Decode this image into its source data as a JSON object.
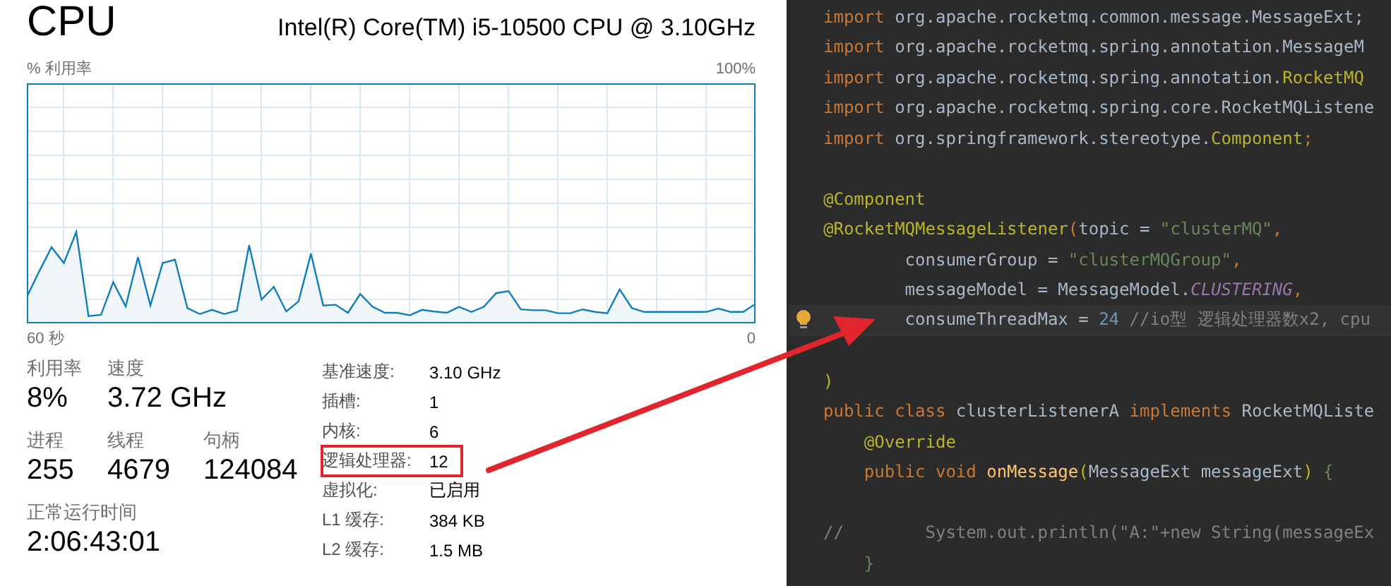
{
  "cpu_panel": {
    "title": "CPU",
    "processor": "Intel(R) Core(TM) i5-10500 CPU @ 3.10GHz",
    "graph": {
      "y_label": "% 利用率",
      "y_max_label": "100%",
      "x_start_label": "60 秒",
      "x_end_label": "0"
    },
    "stats": [
      {
        "label": "利用率",
        "value": "8%"
      },
      {
        "label": "速度",
        "value": "3.72 GHz"
      },
      {
        "label": "进程",
        "value": "255"
      },
      {
        "label": "线程",
        "value": "4679"
      },
      {
        "label": "句柄",
        "value": "124084"
      },
      {
        "label": "正常运行时间",
        "value": "2:06:43:01"
      }
    ],
    "specs": [
      {
        "label": "基准速度:",
        "value": "3.10 GHz",
        "highlighted": false
      },
      {
        "label": "插槽:",
        "value": "1",
        "highlighted": false
      },
      {
        "label": "内核:",
        "value": "6",
        "highlighted": false
      },
      {
        "label": "逻辑处理器:",
        "value": "12",
        "highlighted": true
      },
      {
        "label": "虚拟化:",
        "value": "已启用",
        "highlighted": false
      },
      {
        "label": "L1 缓存:",
        "value": "384 KB",
        "highlighted": false
      },
      {
        "label": "L2 缓存:",
        "value": "1.5 MB",
        "highlighted": false
      }
    ]
  },
  "editor": {
    "lines": [
      {
        "current": false,
        "tokens": [
          {
            "kind": "keyword",
            "text": "import"
          },
          {
            "kind": "plain",
            "text": " org.apache.rocketmq.common.message.MessageExt;"
          }
        ]
      },
      {
        "current": false,
        "tokens": [
          {
            "kind": "keyword",
            "text": "import"
          },
          {
            "kind": "plain",
            "text": " org.apache.rocketmq.spring.annotation.MessageM"
          }
        ]
      },
      {
        "current": false,
        "tokens": [
          {
            "kind": "keyword",
            "text": "import"
          },
          {
            "kind": "plain",
            "text": " org.apache.rocketmq.spring.annotation."
          },
          {
            "kind": "annotation",
            "text": "RocketMQ"
          }
        ]
      },
      {
        "current": false,
        "tokens": [
          {
            "kind": "keyword",
            "text": "import"
          },
          {
            "kind": "plain",
            "text": " org.apache.rocketmq.spring.core.RocketMQListene"
          }
        ]
      },
      {
        "current": false,
        "tokens": [
          {
            "kind": "keyword",
            "text": "import"
          },
          {
            "kind": "plain",
            "text": " org.springframework.stereotype."
          },
          {
            "kind": "annotation",
            "text": "Component"
          },
          {
            "kind": "keyword",
            "text": ";"
          }
        ]
      },
      {
        "current": false
      },
      {
        "current": false,
        "tokens": [
          {
            "kind": "annotation",
            "text": "@Component"
          }
        ]
      },
      {
        "current": false,
        "tokens": [
          {
            "kind": "annotation",
            "text": "@RocketMQMessageListener"
          },
          {
            "kind": "keyword",
            "text": "("
          },
          {
            "kind": "plain",
            "text": "topic = "
          },
          {
            "kind": "string",
            "text": "\"clusterMQ\""
          },
          {
            "kind": "keyword",
            "text": ","
          }
        ]
      },
      {
        "current": false,
        "tokens": [
          {
            "kind": "plain",
            "text": "        consumerGroup = "
          },
          {
            "kind": "string",
            "text": "\"clusterMQGroup\""
          },
          {
            "kind": "keyword",
            "text": ","
          }
        ]
      },
      {
        "current": false,
        "tokens": [
          {
            "kind": "plain",
            "text": "        messageModel = MessageModel."
          },
          {
            "kind": "constant",
            "text": "CLUSTERING"
          },
          {
            "kind": "keyword",
            "text": ","
          }
        ]
      },
      {
        "current": true,
        "tokens": [
          {
            "kind": "plain",
            "text": "        consumeThreadMax = "
          },
          {
            "kind": "number",
            "text": "24"
          },
          {
            "kind": "comment",
            "text": " //io型 逻辑处理器数x2, cpu"
          }
        ]
      },
      {
        "current": false
      },
      {
        "current": false,
        "tokens": [
          {
            "kind": "annotation",
            "text": ")"
          }
        ]
      },
      {
        "current": false,
        "tokens": [
          {
            "kind": "keyword",
            "text": "public class"
          },
          {
            "kind": "plain",
            "text": " clusterListenerA "
          },
          {
            "kind": "keyword",
            "text": "implements"
          },
          {
            "kind": "plain",
            "text": " RocketMQListe"
          }
        ]
      },
      {
        "current": false,
        "tokens": [
          {
            "kind": "annotation",
            "text": "    @Override"
          }
        ]
      },
      {
        "current": false,
        "tokens": [
          {
            "kind": "keyword",
            "text": "    public void"
          },
          {
            "kind": "method",
            "text": " onMessage"
          },
          {
            "kind": "annotation",
            "text": "("
          },
          {
            "kind": "plain",
            "text": "MessageExt messageExt"
          },
          {
            "kind": "annotation",
            "text": ")"
          },
          {
            "kind": "brace",
            "text": " {"
          }
        ]
      },
      {
        "current": false
      },
      {
        "current": false,
        "tokens": [
          {
            "kind": "comment",
            "text": "//        System.out.println(\"A:\"+new String(messageEx"
          }
        ]
      },
      {
        "current": false,
        "tokens": [
          {
            "kind": "brace",
            "text": "    }"
          }
        ]
      }
    ]
  }
}
